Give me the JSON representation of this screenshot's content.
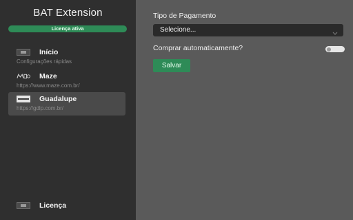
{
  "app": {
    "title": "BAT Extension"
  },
  "license_status": "Licença ativa",
  "sidebar": {
    "items": [
      {
        "id": "inicio",
        "title": "Início",
        "subtitle": "Configurações rápidas",
        "icon": "app-logo-icon",
        "active": false
      },
      {
        "id": "maze",
        "title": "Maze",
        "subtitle": "https://www.maze.com.br/",
        "icon": "maze-logo-icon",
        "active": false
      },
      {
        "id": "guadalupe",
        "title": "Guadalupe",
        "subtitle": "https://gdlp.com.br/",
        "icon": "guadalupe-logo-icon",
        "active": true
      }
    ],
    "footer_item": {
      "title": "Licença",
      "icon": "app-logo-icon"
    }
  },
  "form": {
    "payment_type_label": "Tipo de Pagamento",
    "payment_type_value": "Selecione...",
    "auto_buy_label": "Comprar automaticamente?",
    "auto_buy_enabled": false,
    "save_label": "Salvar"
  },
  "colors": {
    "sidebar_bg": "#2f2f2f",
    "main_bg": "#5a5a5a",
    "accent_green": "#2e8b57",
    "active_item_bg": "#4a4a4a",
    "select_bg": "#2a2a2a"
  }
}
